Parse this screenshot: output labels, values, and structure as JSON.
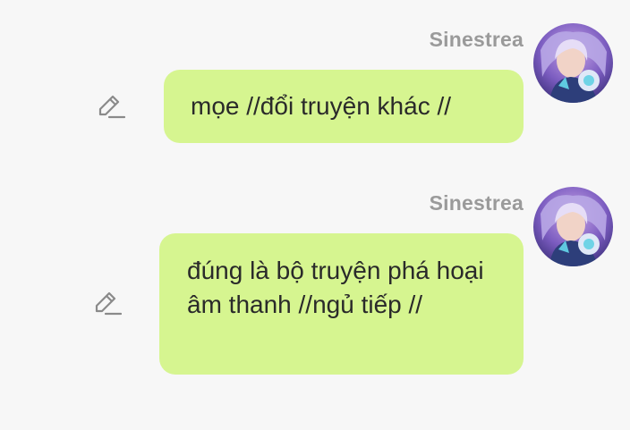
{
  "messages": [
    {
      "sender": "Sinestrea",
      "text": "mọe //đổi truyện khác //",
      "avatar_icon": "avatar-icon",
      "edit_icon": "edit-pencil-icon"
    },
    {
      "sender": "Sinestrea",
      "text": "đúng là bộ truyện phá hoại âm thanh //ngủ tiếp //",
      "avatar_icon": "avatar-icon",
      "edit_icon": "edit-pencil-icon"
    }
  ],
  "colors": {
    "background": "#f7f7f7",
    "bubble": "#d6f590",
    "sender_name": "#9a9a9a",
    "message_text": "#2a2a2a",
    "icon": "#8a8a8a"
  }
}
